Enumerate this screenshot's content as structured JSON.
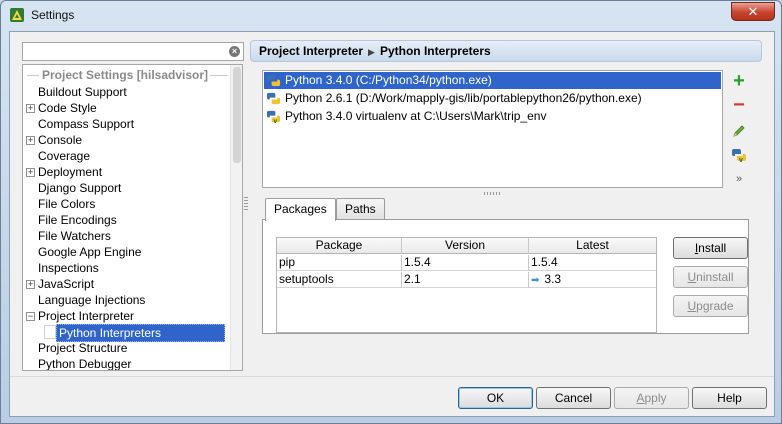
{
  "window": {
    "title": "Settings",
    "close_label": "✕"
  },
  "search": {
    "placeholder": "",
    "value": ""
  },
  "sidebar": {
    "header": "Project Settings [hilsadvisor]",
    "items": [
      {
        "label": "Buildout Support",
        "expandable": false
      },
      {
        "label": "Code Style",
        "expandable": true
      },
      {
        "label": "Compass Support",
        "expandable": false
      },
      {
        "label": "Console",
        "expandable": true
      },
      {
        "label": "Coverage",
        "expandable": false
      },
      {
        "label": "Deployment",
        "expandable": true
      },
      {
        "label": "Django Support",
        "expandable": false
      },
      {
        "label": "File Colors",
        "expandable": false
      },
      {
        "label": "File Encodings",
        "expandable": false
      },
      {
        "label": "File Watchers",
        "expandable": false
      },
      {
        "label": "Google App Engine",
        "expandable": false
      },
      {
        "label": "Inspections",
        "expandable": false
      },
      {
        "label": "JavaScript",
        "expandable": true
      },
      {
        "label": "Language Injections",
        "expandable": false
      },
      {
        "label": "Project Interpreter",
        "expandable": true,
        "expanded": true
      },
      {
        "label": "Python Interpreters",
        "child": true,
        "selected": true
      },
      {
        "label": "Project Structure",
        "expandable": false
      },
      {
        "label": "Python Debugger",
        "expandable": false
      }
    ],
    "expand_plus": "+",
    "expand_minus": "−"
  },
  "breadcrumb": {
    "parent": "Project Interpreter",
    "current": "Python Interpreters",
    "separator": "▶"
  },
  "interpreters": [
    {
      "label": "Python 3.4.0 (C:/Python34/python.exe)",
      "selected": true
    },
    {
      "label": "Python 2.6.1 (D:/Work/mapply-gis/lib/portablepython26/python.exe)",
      "selected": false
    },
    {
      "label": "Python 3.4.0 virtualenv at C:\\Users\\Mark\\trip_env",
      "selected": false
    }
  ],
  "tools": {
    "add": "+",
    "remove": "−",
    "more": "»"
  },
  "tabs": [
    {
      "label": "Packages",
      "active": true
    },
    {
      "label": "Paths",
      "active": false
    }
  ],
  "packages": {
    "columns": [
      "Package",
      "Version",
      "Latest"
    ],
    "rows": [
      {
        "package": "pip",
        "version": "1.5.4",
        "latest": "1.5.4",
        "upgrade": false
      },
      {
        "package": "setuptools",
        "version": "2.1",
        "latest": "3.3",
        "upgrade": true
      }
    ],
    "upgrade_arrow": "➡"
  },
  "package_buttons": {
    "install_key": "I",
    "install_rest": "nstall",
    "uninstall_key": "U",
    "uninstall_rest": "ninstall",
    "upgrade_key": "U",
    "upgrade_rest": "pgrade"
  },
  "dialog_buttons": {
    "ok": "OK",
    "cancel": "Cancel",
    "apply_key": "A",
    "apply_rest": "pply",
    "help": "Help"
  },
  "colors": {
    "selection": "#2f65ca",
    "add": "#2ca02c",
    "remove": "#d23b2b"
  }
}
